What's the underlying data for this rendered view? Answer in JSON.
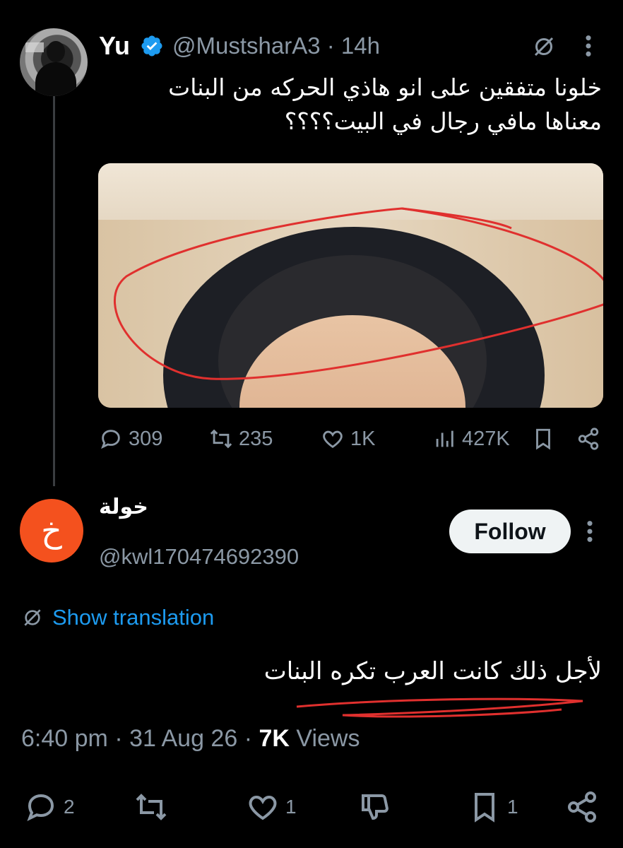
{
  "tweet": {
    "author_name": "Yu",
    "handle": "@MustsharA3",
    "separator": "·",
    "time": "14h",
    "text_line1": "خلونا متفقين على انو هاذي  الحركه من البنات",
    "text_line2": "معناها مافي رجال في البيت؟؟؟؟",
    "stats": {
      "replies": "309",
      "reposts": "235",
      "likes": "1K",
      "views": "427K"
    }
  },
  "reply": {
    "avatar_letter": "خ",
    "author_name": "خولة",
    "handle": "@kwl170474692390",
    "follow_label": "Follow",
    "translate_label": "Show translation",
    "text": "لأجل ذلك كانت العرب تكره البنات",
    "time": "6:40 pm",
    "date": "31 Aug 26",
    "views_count": "7K",
    "views_label": "Views",
    "actions": {
      "replies": "2",
      "likes": "1",
      "bookmarks": "1"
    }
  },
  "colors": {
    "background": "#000000",
    "link": "#1d9bf0",
    "muted": "#8b98a5",
    "avatar_orange": "#f4511e",
    "annotation_red": "#e0302e"
  }
}
